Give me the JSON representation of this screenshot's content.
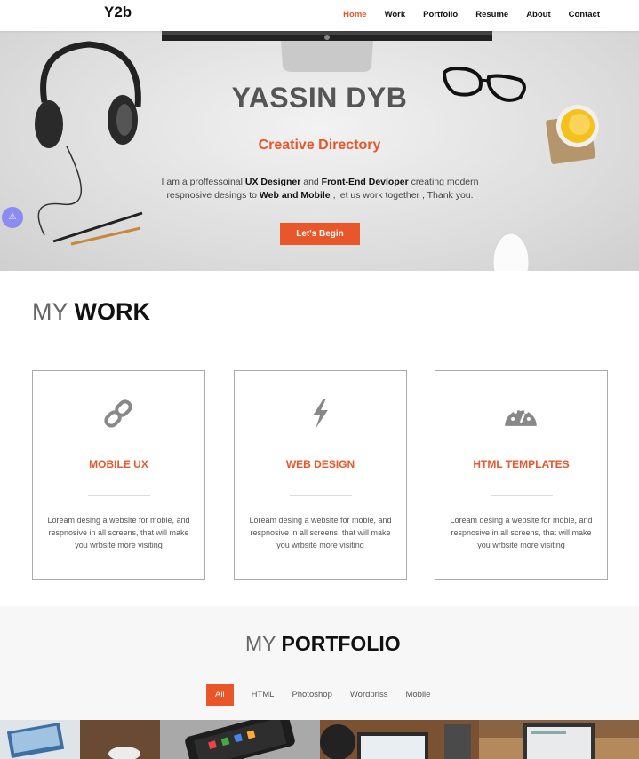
{
  "header": {
    "logo": "Y2b",
    "nav": [
      {
        "label": "Home",
        "active": true
      },
      {
        "label": "Work"
      },
      {
        "label": "Portfolio"
      },
      {
        "label": "Resume"
      },
      {
        "label": "About"
      },
      {
        "label": "Contact"
      }
    ]
  },
  "hero": {
    "title": "YASSIN DYB",
    "subtitle": "Creative Directory",
    "text": {
      "part1": "I am a proffessoinal ",
      "bold1": "UX Designer",
      "part2": " and ",
      "bold2": "Front-End Devloper",
      "part3": " creating modern respnosive desings to ",
      "bold3": "Web and Mobile",
      "part4": " , let us work together , Thank you."
    },
    "button": "Let's Begin"
  },
  "alert": {
    "icon": "warning-icon",
    "glyph": "⚠"
  },
  "work": {
    "title_light": "MY",
    "title_bold": "WORK",
    "cards": [
      {
        "icon": "link-icon",
        "title": "MOBILE UX",
        "desc": "Loream desing a website for moble, and respnosive in all screens, that will make you wrbsite more visiting"
      },
      {
        "icon": "bolt-icon",
        "title": "WEB DESIGN",
        "desc": "Loream desing a website for moble, and respnosive in all screens, that will make you wrbsite more visiting"
      },
      {
        "icon": "dashboard-icon",
        "title": "HTML TEMPLATES",
        "desc": "Loream desing a website for moble, and respnosive in all screens, that will make you wrbsite more visiting"
      }
    ]
  },
  "portfolio": {
    "title_light": "MY",
    "title_bold": "PORTFOLIO",
    "filters": [
      {
        "label": "All",
        "active": true
      },
      {
        "label": "HTML"
      },
      {
        "label": "Photoshop"
      },
      {
        "label": "Wordpriss"
      },
      {
        "label": "Mobile"
      }
    ]
  },
  "colors": {
    "accent": "#e8562a",
    "text": "#111111",
    "muted": "#666666"
  }
}
